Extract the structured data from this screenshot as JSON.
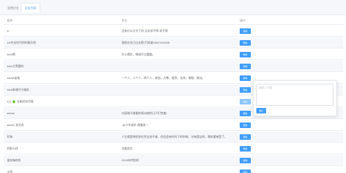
{
  "tabs": [
    {
      "label": "配置信息",
      "active": false
    },
    {
      "label": "好友列表",
      "active": true
    }
  ],
  "table": {
    "headers": {
      "name": "昵称",
      "sign": "签名",
      "action": "操作"
    },
    "rows": [
      {
        "name": "A",
        "sign": "没有什么大不了的 无非求不得 求不得",
        "action": "删除"
      },
      {
        "name": "AD作业时代同时聊天吧",
        "sign": "我现在先已过去啊 们知道15821190526",
        "action": "删除"
      },
      {
        "name": "AAA啊",
        "sign": "开心就好，情谊不太重要。",
        "action": "删除"
      },
      {
        "name": "AAA大黑鹿的",
        "sign": "",
        "action": "删除"
      },
      {
        "name": "AAAA苗电",
        "sign": "一个人，二个人，四个人，参加，方寒，爱到，北纬，香橙，推化。",
        "action": "删除"
      },
      {
        "name": "AAA新课代卡服务",
        "sign": "",
        "action": "删除"
      },
      {
        "name": "A A",
        "name_suffix": "全新优化代理",
        "sign": "",
        "action": "删除"
      },
      {
        "name": "admin",
        "sign": "内容和不难看的两句就的日子们完美!",
        "action": "删除"
      },
      {
        "name": "adobe 关开启",
        "sign": "-@小华说作-理服务一",
        "action": "删除"
      },
      {
        "name": "阿海",
        "sign": "人生就是将很多往完全选不难，但还会有时光下的时刻，它每是这的，哦的要感受了。",
        "action": "删除"
      },
      {
        "name": "阿斯卡伊",
        "sign": "也要男生",
        "action": "删除"
      },
      {
        "name": "爱吃咖的鱼",
        "sign": "2023年特别的",
        "action": "删除"
      },
      {
        "name": "艾菲",
        "sign": "",
        "action": "删除"
      }
    ]
  },
  "popover": {
    "placeholder": "请输入内容",
    "confirm_label": "确认"
  },
  "colors": {
    "primary": "#409eff",
    "primary_light": "#8cc5ff",
    "online_dot": "#67c23a"
  }
}
